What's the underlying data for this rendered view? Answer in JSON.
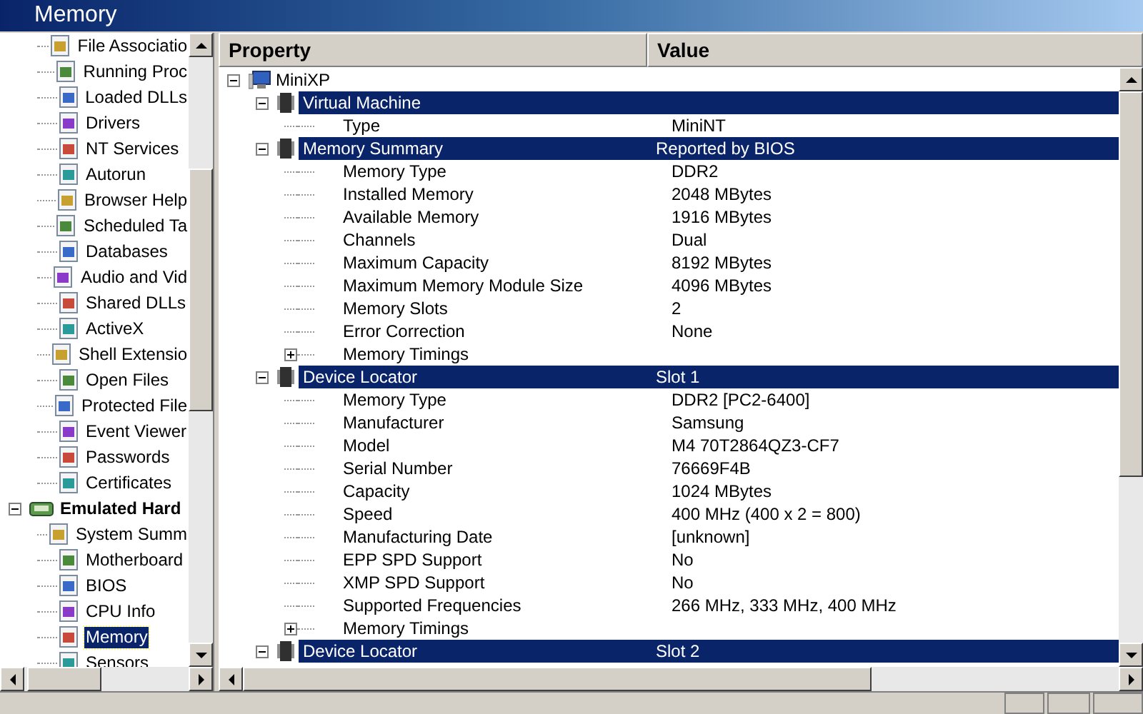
{
  "window": {
    "title": "Memory"
  },
  "sidebar": {
    "continued_items": [
      {
        "label": "File Associatio",
        "selected": false
      },
      {
        "label": "Running Proc",
        "selected": false
      },
      {
        "label": "Loaded DLLs",
        "selected": false
      },
      {
        "label": "Drivers",
        "selected": false
      },
      {
        "label": "NT Services",
        "selected": false
      },
      {
        "label": "Autorun",
        "selected": false
      },
      {
        "label": "Browser Help",
        "selected": false
      },
      {
        "label": "Scheduled Ta",
        "selected": false
      },
      {
        "label": "Databases",
        "selected": false
      },
      {
        "label": "Audio and Vid",
        "selected": false
      },
      {
        "label": "Shared DLLs",
        "selected": false
      },
      {
        "label": "ActiveX",
        "selected": false
      },
      {
        "label": "Shell Extensio",
        "selected": false
      },
      {
        "label": "Open Files",
        "selected": false
      },
      {
        "label": "Protected File",
        "selected": false
      },
      {
        "label": "Event Viewer",
        "selected": false
      },
      {
        "label": "Passwords",
        "selected": false
      },
      {
        "label": "Certificates",
        "selected": false
      }
    ],
    "items": [
      {
        "label": "Emulated Hard",
        "selected": false,
        "expanded": true,
        "children": [
          {
            "label": "System Summ",
            "selected": false
          },
          {
            "label": "Motherboard",
            "selected": false
          },
          {
            "label": "BIOS",
            "selected": false
          },
          {
            "label": "CPU Info",
            "selected": false
          },
          {
            "label": "Memory",
            "selected": true
          },
          {
            "label": "Sensors",
            "selected": false
          }
        ]
      }
    ]
  },
  "table": {
    "columns": [
      "Property",
      "Value"
    ],
    "rows": [
      {
        "kind": "root",
        "property": "MiniXP",
        "expanded": true,
        "children": [
          {
            "kind": "section",
            "property": "Virtual Machine",
            "expanded": true,
            "children": [
              {
                "kind": "item",
                "property": "Type",
                "value": "MiniNT"
              }
            ]
          },
          {
            "kind": "section",
            "property": "Memory Summary",
            "value": "Reported by BIOS",
            "expanded": true,
            "children": [
              {
                "kind": "item",
                "property": "Memory Type",
                "value": "DDR2"
              },
              {
                "kind": "item",
                "property": "Installed Memory",
                "value": "2048 MBytes"
              },
              {
                "kind": "item",
                "property": "Available Memory",
                "value": "1916 MBytes"
              },
              {
                "kind": "item",
                "property": "Channels",
                "value": "Dual"
              },
              {
                "kind": "item",
                "property": "Maximum Capacity",
                "value": "8192 MBytes"
              },
              {
                "kind": "item",
                "property": "Maximum Memory Module Size",
                "value": "4096 MBytes"
              },
              {
                "kind": "item",
                "property": "Memory Slots",
                "value": "2"
              },
              {
                "kind": "item",
                "property": "Error Correction",
                "value": "None"
              },
              {
                "kind": "group",
                "property": "Memory Timings",
                "expanded": false
              }
            ]
          },
          {
            "kind": "section",
            "property": "Device Locator",
            "value": "Slot 1",
            "expanded": true,
            "children": [
              {
                "kind": "item",
                "property": "Memory Type",
                "value": "DDR2 [PC2-6400]"
              },
              {
                "kind": "item",
                "property": "Manufacturer",
                "value": "Samsung"
              },
              {
                "kind": "item",
                "property": "Model",
                "value": "M4 70T2864QZ3-CF7"
              },
              {
                "kind": "item",
                "property": "Serial Number",
                "value": "76669F4B"
              },
              {
                "kind": "item",
                "property": "Capacity",
                "value": "1024 MBytes"
              },
              {
                "kind": "item",
                "property": "Speed",
                "value": "400 MHz (400 x 2 = 800)"
              },
              {
                "kind": "item",
                "property": "Manufacturing Date",
                "value": "[unknown]"
              },
              {
                "kind": "item",
                "property": "EPP SPD Support",
                "value": "No"
              },
              {
                "kind": "item",
                "property": "XMP SPD Support",
                "value": "No"
              },
              {
                "kind": "item",
                "property": "Supported Frequencies",
                "value": "266 MHz, 333 MHz, 400 MHz"
              },
              {
                "kind": "group",
                "property": "Memory Timings",
                "expanded": false
              }
            ]
          },
          {
            "kind": "section",
            "property": "Device Locator",
            "value": "Slot 2",
            "expanded": true
          }
        ]
      }
    ]
  }
}
